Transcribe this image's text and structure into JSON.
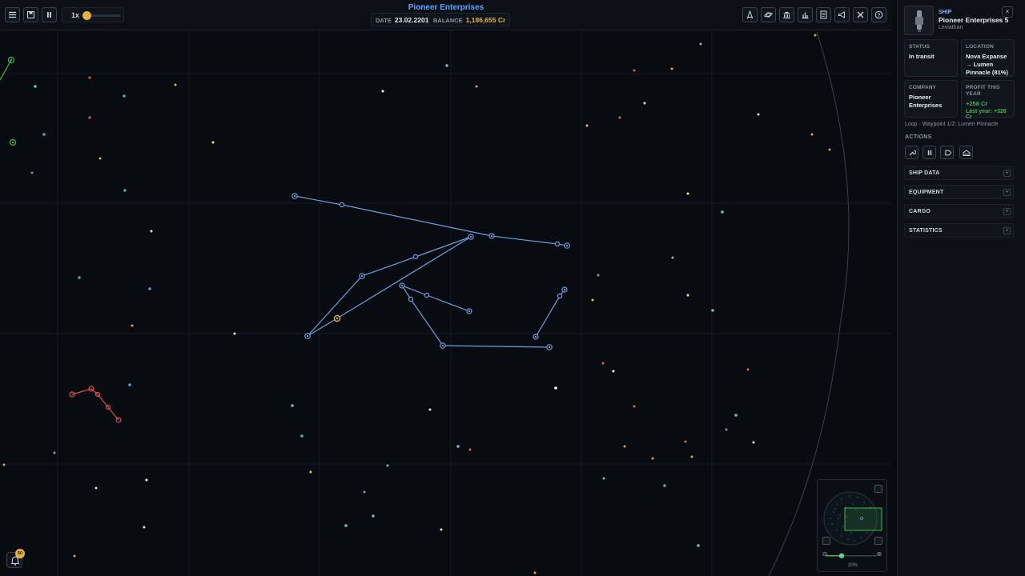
{
  "topbar": {
    "company": "Pioneer Enterprises",
    "speed": "1x",
    "date_label": "DATE",
    "date_value": "23.02.2201",
    "balance_label": "BALANCE",
    "balance_value": "1,186,655 Cr",
    "left_buttons": [
      "menu-icon",
      "save-icon",
      "pause-icon"
    ],
    "right_buttons": [
      "ship-icon",
      "planet-icon",
      "bank-icon",
      "chart-icon",
      "document-icon",
      "megaphone-icon",
      "tools-icon",
      "help-icon"
    ]
  },
  "panel": {
    "kind": "SHIP",
    "name": "Pioneer Enterprises 5",
    "class": "Leviathan",
    "close": "×",
    "status": {
      "label": "STATUS",
      "value": "In transit"
    },
    "location": {
      "label": "LOCATION",
      "value": "Nova Expanse → Lumen Pinnacle (81%)"
    },
    "company": {
      "label": "COMPANY",
      "value": "Pioneer Enterprises"
    },
    "profit": {
      "label": "PROFIT THIS YEAR",
      "value": "+258 Cr",
      "last_year": "Last year: +326 Cr"
    },
    "loop": "Loop · Waypoint 1/2: Lumen Pinnacle",
    "actions_title": "ACTIONS",
    "actions": [
      "wrench-icon",
      "pause-icon",
      "tag-icon",
      "depot-icon"
    ],
    "sections": [
      {
        "title": "SHIP DATA",
        "toggle": "+"
      },
      {
        "title": "EQUIPMENT",
        "toggle": "+"
      },
      {
        "title": "CARGO",
        "toggle": "+"
      },
      {
        "title": "STATISTICS",
        "toggle": "+"
      }
    ]
  },
  "minimap": {
    "zoom": "20%"
  },
  "notifications": {
    "count": "50"
  },
  "colors": {
    "accent": "#58a6ff",
    "route_blue": "#6f9fe0",
    "route_red": "#d9534f",
    "route_green": "#3fb950",
    "gold": "#e3b341"
  }
}
